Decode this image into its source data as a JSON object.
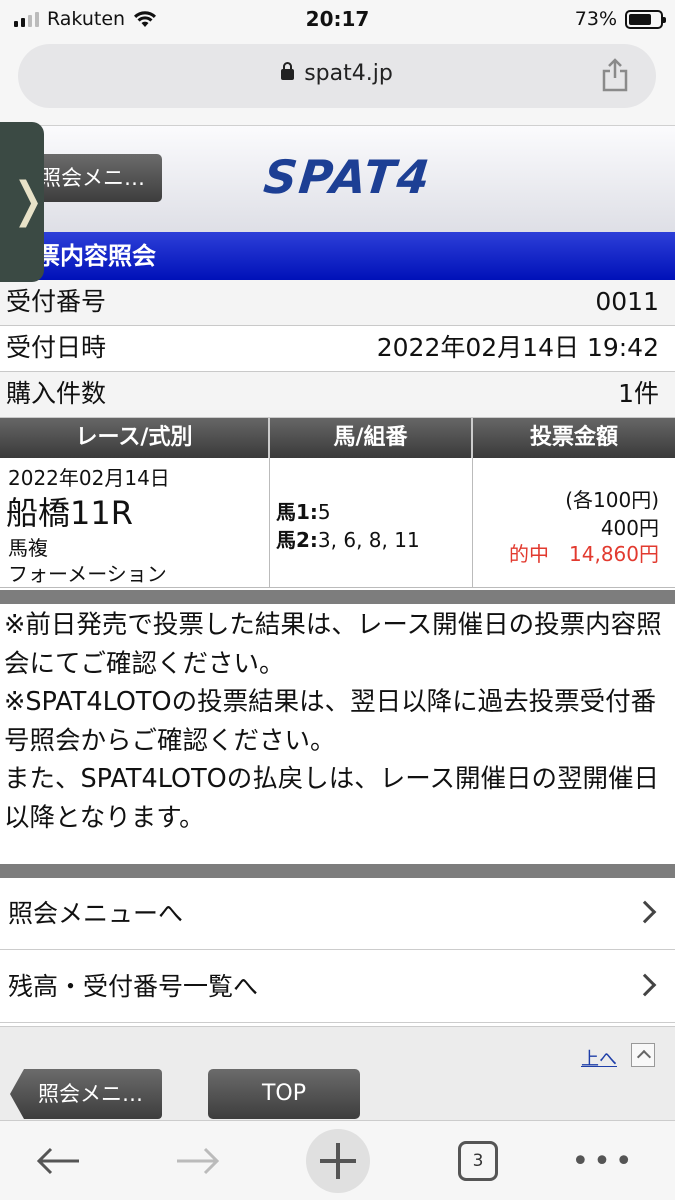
{
  "status_bar": {
    "carrier": "Rakuten",
    "time": "20:17",
    "battery": "73%",
    "battery_level": 0.73
  },
  "browser": {
    "url": "spat4.jp"
  },
  "header": {
    "back_button": "照会メニ…",
    "logo": "SPAT4",
    "side_tab": "❭"
  },
  "section_title": "投票内容照会",
  "info": {
    "receipt_no_label": "受付番号",
    "receipt_no": "0011",
    "receipt_time_label": "受付日時",
    "receipt_time": "2022年02月14日 19:42",
    "count_label": "購入件数",
    "count": "1件"
  },
  "table": {
    "headers": [
      "レース/式別",
      "馬/組番",
      "投票金額"
    ],
    "row": {
      "date": "2022年02月14日",
      "race": "船橋11R",
      "bet_type": "馬複",
      "method": "フォーメーション",
      "horse1_label": "馬1:",
      "horse1": "5",
      "horse2_label": "馬2:",
      "horse2": "3, 6, 8, 11",
      "unit": "(各100円)",
      "amount": "400円",
      "hit": "的中　14,860円"
    }
  },
  "notes": [
    "※前日発売で投票した結果は、レース開催日の投票内容照会にてご確認ください。",
    "※SPAT4LOTOの投票結果は、翌日以降に過去投票受付番号照会からご確認ください。",
    "また、SPAT4LOTOの払戻しは、レース開催日の翌開催日以降となります。"
  ],
  "menu": [
    {
      "label": "照会メニューへ"
    },
    {
      "label": "残高・受付番号一覧へ"
    }
  ],
  "footer": {
    "to_top": "上へ",
    "back_button": "照会メニ…",
    "top_button": "TOP"
  },
  "toolbar": {
    "tab_count": "3"
  },
  "colors": {
    "title_bg": "#0011b8",
    "logo": "#1d3f94",
    "hit": "#e23a2f"
  }
}
